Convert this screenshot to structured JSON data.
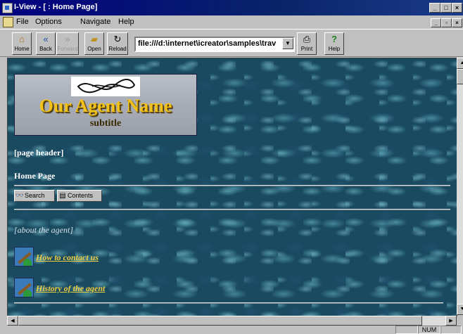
{
  "window": {
    "title": "I-View - [ : Home Page]"
  },
  "menu": {
    "items": [
      "File",
      "Options",
      "Navigate",
      "Help"
    ]
  },
  "toolbar": {
    "home": "Home",
    "back": "Back",
    "forward": "Forward",
    "open": "Open",
    "reload": "Reload",
    "url": "file:///d:\\internet\\icreator\\samples\\trav",
    "print": "Print",
    "help": "Help"
  },
  "page": {
    "banner_title": "Our Agent Name",
    "banner_subtitle": "subtitle",
    "page_header": "[page header]",
    "heading": "Home Page",
    "search_label": "Search",
    "contents_label": "Contents",
    "about": "[about the agent]",
    "links": [
      "How to contact us",
      "History of the agent"
    ]
  },
  "status": {
    "num": "NUM"
  }
}
